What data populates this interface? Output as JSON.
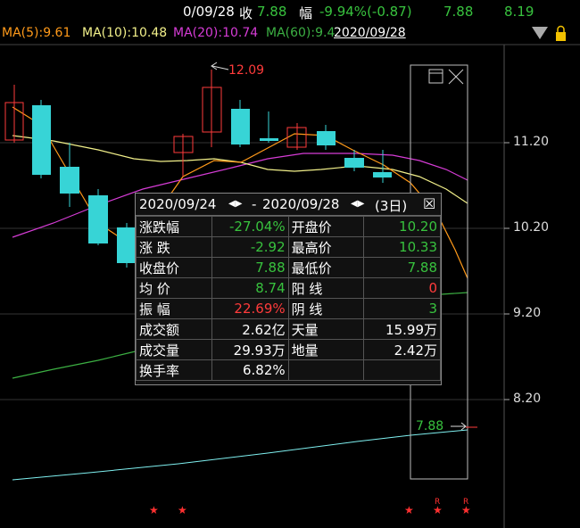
{
  "topbar": {
    "date": "0/09/28",
    "close_label": "收",
    "close_value": "7.88",
    "change_label": "幅",
    "change_value": "-9.94%(-0.87)",
    "value2": "7.88",
    "value3": "8.19"
  },
  "ma_bar": {
    "ma5": "MA(5):9.61",
    "ma10": "MA(10):10.48",
    "ma20": "MA(20):10.74",
    "ma60": "MA(60):9.4",
    "date_tag": "2020/09/28"
  },
  "price_axis": [
    "11.20",
    "10.20",
    "9.20",
    "8.20"
  ],
  "annotations": {
    "high": "12.09",
    "last": "7.88"
  },
  "colors": {
    "up": "#ff3b3b",
    "down": "#37d4d6",
    "ma5": "#ff9a1a",
    "ma10": "#f2f08a",
    "ma20": "#d63cd6",
    "ma60": "#3cb043"
  },
  "popup": {
    "range_start": "2020/09/24",
    "range_sep": "-",
    "range_end": "2020/09/28",
    "days": "(3日)",
    "rows": [
      {
        "l1": "涨跌幅",
        "v1": "-27.04%",
        "l2": "开盘价",
        "v2": "10.20"
      },
      {
        "l1": "涨  跌",
        "v1": "-2.92",
        "l2": "最高价",
        "v2": "10.33"
      },
      {
        "l1": "收盘价",
        "v1": "7.88",
        "l2": "最低价",
        "v2": "7.88"
      },
      {
        "l1": "均  价",
        "v1": "8.74",
        "l2": "阳  线",
        "v2": "0"
      },
      {
        "l1": "振  幅",
        "v1": "22.69%",
        "l2": "阴  线",
        "v2": "3"
      },
      {
        "l1": "成交额",
        "v1": "2.62亿",
        "l2": "天量",
        "v2": "15.99万"
      },
      {
        "l1": "成交量",
        "v1": "29.93万",
        "l2": "地量",
        "v2": "2.42万"
      },
      {
        "l1": "换手率",
        "v1": "6.82%",
        "l2": "",
        "v2": ""
      }
    ]
  },
  "markers": {
    "star": "★",
    "r": "R"
  }
}
